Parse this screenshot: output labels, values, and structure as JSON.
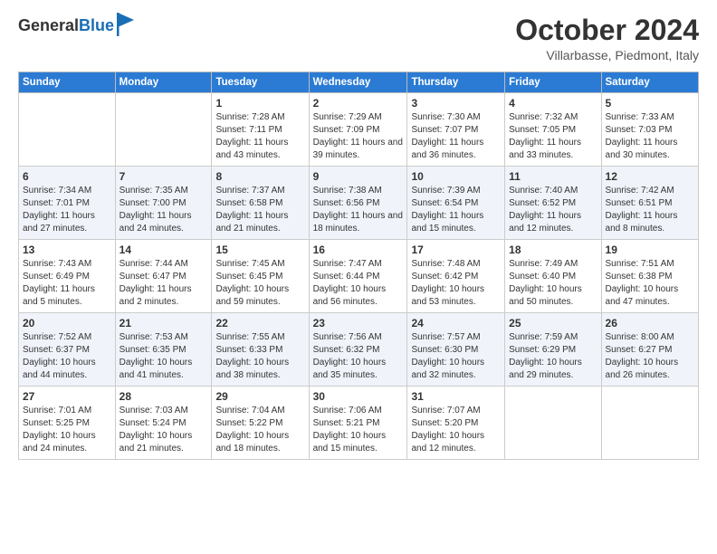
{
  "header": {
    "logo_general": "General",
    "logo_blue": "Blue",
    "month_title": "October 2024",
    "location": "Villarbasse, Piedmont, Italy"
  },
  "weekdays": [
    "Sunday",
    "Monday",
    "Tuesday",
    "Wednesday",
    "Thursday",
    "Friday",
    "Saturday"
  ],
  "weeks": [
    [
      {
        "day": "",
        "sunrise": "",
        "sunset": "",
        "daylight": ""
      },
      {
        "day": "",
        "sunrise": "",
        "sunset": "",
        "daylight": ""
      },
      {
        "day": "1",
        "sunrise": "Sunrise: 7:28 AM",
        "sunset": "Sunset: 7:11 PM",
        "daylight": "Daylight: 11 hours and 43 minutes."
      },
      {
        "day": "2",
        "sunrise": "Sunrise: 7:29 AM",
        "sunset": "Sunset: 7:09 PM",
        "daylight": "Daylight: 11 hours and 39 minutes."
      },
      {
        "day": "3",
        "sunrise": "Sunrise: 7:30 AM",
        "sunset": "Sunset: 7:07 PM",
        "daylight": "Daylight: 11 hours and 36 minutes."
      },
      {
        "day": "4",
        "sunrise": "Sunrise: 7:32 AM",
        "sunset": "Sunset: 7:05 PM",
        "daylight": "Daylight: 11 hours and 33 minutes."
      },
      {
        "day": "5",
        "sunrise": "Sunrise: 7:33 AM",
        "sunset": "Sunset: 7:03 PM",
        "daylight": "Daylight: 11 hours and 30 minutes."
      }
    ],
    [
      {
        "day": "6",
        "sunrise": "Sunrise: 7:34 AM",
        "sunset": "Sunset: 7:01 PM",
        "daylight": "Daylight: 11 hours and 27 minutes."
      },
      {
        "day": "7",
        "sunrise": "Sunrise: 7:35 AM",
        "sunset": "Sunset: 7:00 PM",
        "daylight": "Daylight: 11 hours and 24 minutes."
      },
      {
        "day": "8",
        "sunrise": "Sunrise: 7:37 AM",
        "sunset": "Sunset: 6:58 PM",
        "daylight": "Daylight: 11 hours and 21 minutes."
      },
      {
        "day": "9",
        "sunrise": "Sunrise: 7:38 AM",
        "sunset": "Sunset: 6:56 PM",
        "daylight": "Daylight: 11 hours and 18 minutes."
      },
      {
        "day": "10",
        "sunrise": "Sunrise: 7:39 AM",
        "sunset": "Sunset: 6:54 PM",
        "daylight": "Daylight: 11 hours and 15 minutes."
      },
      {
        "day": "11",
        "sunrise": "Sunrise: 7:40 AM",
        "sunset": "Sunset: 6:52 PM",
        "daylight": "Daylight: 11 hours and 12 minutes."
      },
      {
        "day": "12",
        "sunrise": "Sunrise: 7:42 AM",
        "sunset": "Sunset: 6:51 PM",
        "daylight": "Daylight: 11 hours and 8 minutes."
      }
    ],
    [
      {
        "day": "13",
        "sunrise": "Sunrise: 7:43 AM",
        "sunset": "Sunset: 6:49 PM",
        "daylight": "Daylight: 11 hours and 5 minutes."
      },
      {
        "day": "14",
        "sunrise": "Sunrise: 7:44 AM",
        "sunset": "Sunset: 6:47 PM",
        "daylight": "Daylight: 11 hours and 2 minutes."
      },
      {
        "day": "15",
        "sunrise": "Sunrise: 7:45 AM",
        "sunset": "Sunset: 6:45 PM",
        "daylight": "Daylight: 10 hours and 59 minutes."
      },
      {
        "day": "16",
        "sunrise": "Sunrise: 7:47 AM",
        "sunset": "Sunset: 6:44 PM",
        "daylight": "Daylight: 10 hours and 56 minutes."
      },
      {
        "day": "17",
        "sunrise": "Sunrise: 7:48 AM",
        "sunset": "Sunset: 6:42 PM",
        "daylight": "Daylight: 10 hours and 53 minutes."
      },
      {
        "day": "18",
        "sunrise": "Sunrise: 7:49 AM",
        "sunset": "Sunset: 6:40 PM",
        "daylight": "Daylight: 10 hours and 50 minutes."
      },
      {
        "day": "19",
        "sunrise": "Sunrise: 7:51 AM",
        "sunset": "Sunset: 6:38 PM",
        "daylight": "Daylight: 10 hours and 47 minutes."
      }
    ],
    [
      {
        "day": "20",
        "sunrise": "Sunrise: 7:52 AM",
        "sunset": "Sunset: 6:37 PM",
        "daylight": "Daylight: 10 hours and 44 minutes."
      },
      {
        "day": "21",
        "sunrise": "Sunrise: 7:53 AM",
        "sunset": "Sunset: 6:35 PM",
        "daylight": "Daylight: 10 hours and 41 minutes."
      },
      {
        "day": "22",
        "sunrise": "Sunrise: 7:55 AM",
        "sunset": "Sunset: 6:33 PM",
        "daylight": "Daylight: 10 hours and 38 minutes."
      },
      {
        "day": "23",
        "sunrise": "Sunrise: 7:56 AM",
        "sunset": "Sunset: 6:32 PM",
        "daylight": "Daylight: 10 hours and 35 minutes."
      },
      {
        "day": "24",
        "sunrise": "Sunrise: 7:57 AM",
        "sunset": "Sunset: 6:30 PM",
        "daylight": "Daylight: 10 hours and 32 minutes."
      },
      {
        "day": "25",
        "sunrise": "Sunrise: 7:59 AM",
        "sunset": "Sunset: 6:29 PM",
        "daylight": "Daylight: 10 hours and 29 minutes."
      },
      {
        "day": "26",
        "sunrise": "Sunrise: 8:00 AM",
        "sunset": "Sunset: 6:27 PM",
        "daylight": "Daylight: 10 hours and 26 minutes."
      }
    ],
    [
      {
        "day": "27",
        "sunrise": "Sunrise: 7:01 AM",
        "sunset": "Sunset: 5:25 PM",
        "daylight": "Daylight: 10 hours and 24 minutes."
      },
      {
        "day": "28",
        "sunrise": "Sunrise: 7:03 AM",
        "sunset": "Sunset: 5:24 PM",
        "daylight": "Daylight: 10 hours and 21 minutes."
      },
      {
        "day": "29",
        "sunrise": "Sunrise: 7:04 AM",
        "sunset": "Sunset: 5:22 PM",
        "daylight": "Daylight: 10 hours and 18 minutes."
      },
      {
        "day": "30",
        "sunrise": "Sunrise: 7:06 AM",
        "sunset": "Sunset: 5:21 PM",
        "daylight": "Daylight: 10 hours and 15 minutes."
      },
      {
        "day": "31",
        "sunrise": "Sunrise: 7:07 AM",
        "sunset": "Sunset: 5:20 PM",
        "daylight": "Daylight: 10 hours and 12 minutes."
      },
      {
        "day": "",
        "sunrise": "",
        "sunset": "",
        "daylight": ""
      },
      {
        "day": "",
        "sunrise": "",
        "sunset": "",
        "daylight": ""
      }
    ]
  ]
}
